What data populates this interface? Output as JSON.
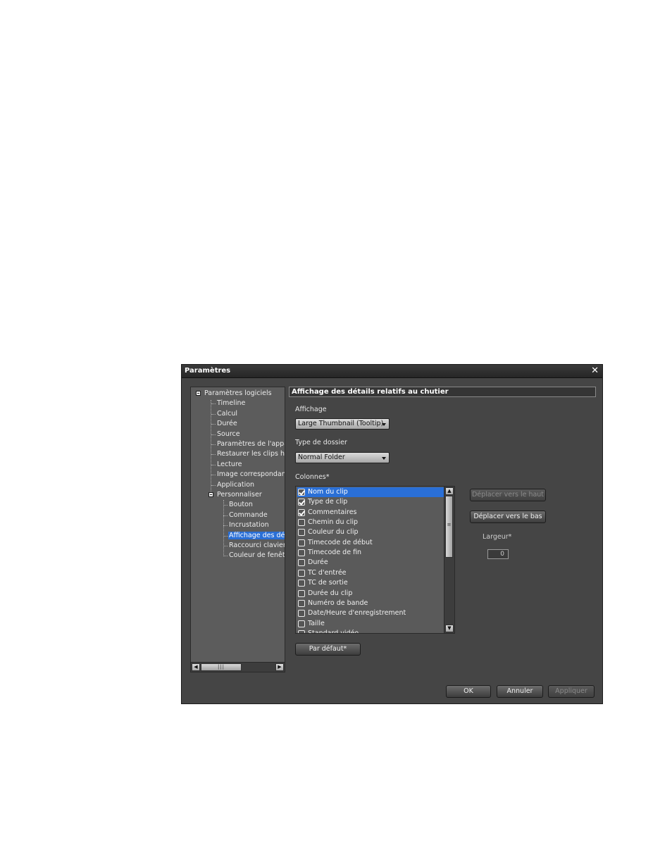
{
  "window": {
    "title": "Paramètres"
  },
  "tree": {
    "items": [
      {
        "label": "Paramètres logiciels",
        "level": 0,
        "expandable": true
      },
      {
        "label": "Timeline",
        "level": 1
      },
      {
        "label": "Calcul",
        "level": 1
      },
      {
        "label": "Durée",
        "level": 1
      },
      {
        "label": "Source",
        "level": 1
      },
      {
        "label": "Paramètres de l'appar",
        "level": 1
      },
      {
        "label": "Restaurer les clips hor",
        "level": 1
      },
      {
        "label": "Lecture",
        "level": 1
      },
      {
        "label": "Image correspondante",
        "level": 1
      },
      {
        "label": "Application",
        "level": 1
      },
      {
        "label": "Personnaliser",
        "level": 1,
        "expandable": true
      },
      {
        "label": "Bouton",
        "level": 2
      },
      {
        "label": "Commande",
        "level": 2
      },
      {
        "label": "Incrustation",
        "level": 2
      },
      {
        "label": "Affichage des déta",
        "level": 2,
        "selected": true
      },
      {
        "label": "Raccourci clavier",
        "level": 2
      },
      {
        "label": "Couleur de fenêtre",
        "level": 2
      }
    ]
  },
  "panel": {
    "header": "Affichage des détails relatifs au chutier",
    "affichage": {
      "label": "Affichage",
      "value": "Large Thumbnail (Tooltip)"
    },
    "type_dossier": {
      "label": "Type de dossier",
      "value": "Normal Folder"
    },
    "colonnes": {
      "label": "Colonnes*",
      "items": [
        {
          "label": "Nom du clip",
          "checked": true,
          "selected": true
        },
        {
          "label": "Type de clip",
          "checked": true
        },
        {
          "label": "Commentaires",
          "checked": true
        },
        {
          "label": "Chemin du clip",
          "checked": false
        },
        {
          "label": "Couleur du clip",
          "checked": false
        },
        {
          "label": "Timecode de début",
          "checked": false
        },
        {
          "label": "Timecode de fin",
          "checked": false
        },
        {
          "label": "Durée",
          "checked": false
        },
        {
          "label": "TC d'entrée",
          "checked": false
        },
        {
          "label": "TC de sortie",
          "checked": false
        },
        {
          "label": "Durée du clip",
          "checked": false
        },
        {
          "label": "Numéro de bande",
          "checked": false
        },
        {
          "label": "Date/Heure d'enregistrement",
          "checked": false
        },
        {
          "label": "Taille",
          "checked": false
        },
        {
          "label": "Standard vidéo",
          "checked": false
        }
      ]
    },
    "move_up": "Déplacer vers le haut",
    "move_down": "Déplacer vers le bas",
    "largeur_label": "Largeur*",
    "largeur_value": "0",
    "default_button": "Par défaut*"
  },
  "footer": {
    "ok": "OK",
    "cancel": "Annuler",
    "apply": "Appliquer"
  },
  "colors": {
    "dialog_bg": "#454545",
    "selection": "#2a6fd6"
  }
}
